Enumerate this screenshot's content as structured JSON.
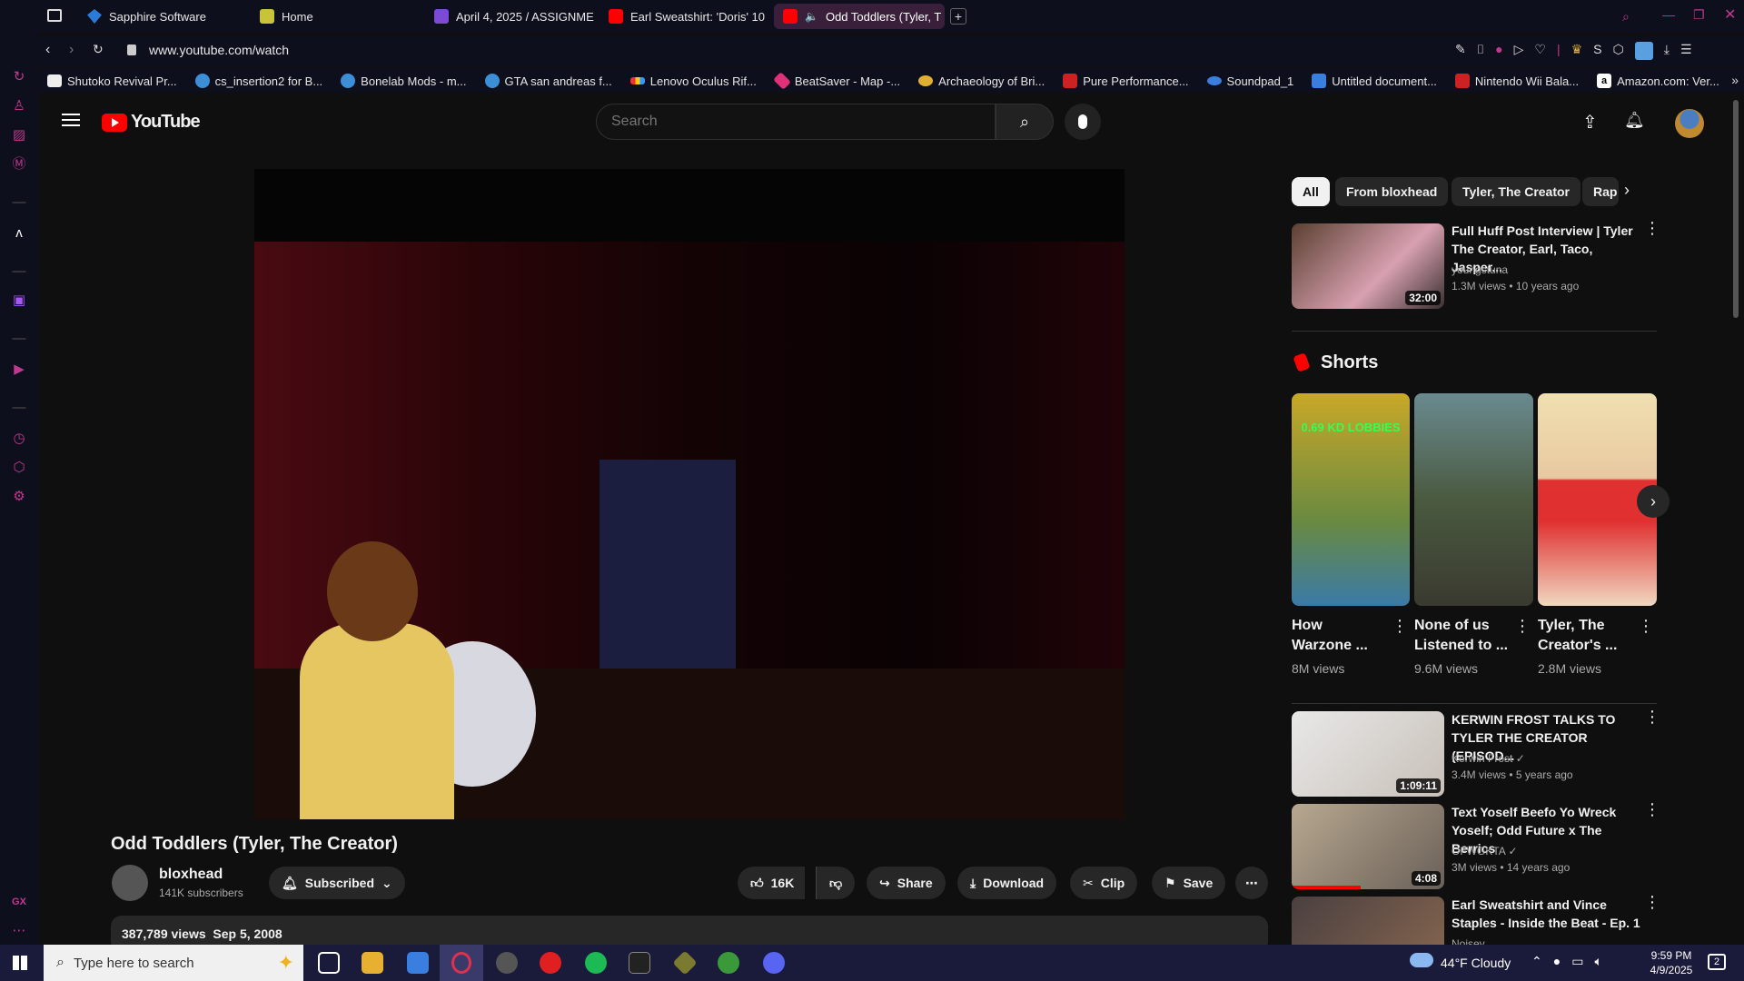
{
  "browser": {
    "tabs": [
      {
        "label": "Sapphire Software",
        "color": "#2b7bd6"
      },
      {
        "label": "Home",
        "color": "#c8c43a"
      },
      {
        "label": "April 4, 2025 / ASSIGNME",
        "color": "#7a4bd6"
      },
      {
        "label": "Earl Sweatshirt: 'Doris' 10",
        "color": "#ff0000"
      },
      {
        "label": "Odd Toddlers (Tyler, T",
        "color": "#ff0000",
        "active": true
      }
    ],
    "url": "www.youtube.com/watch",
    "bookmarks": [
      "Shutoko Revival Pr...",
      "cs_insertion2 for B...",
      "Bonelab Mods - m...",
      "GTA san andreas f...",
      "Lenovo Oculus Rif...",
      "BeatSaver - Map -...",
      "Archaeology of Bri...",
      "Pure Performance...",
      "Soundpad_1",
      "Untitled document...",
      "Nintendo Wii Bala...",
      "Amazon.com: Ver..."
    ]
  },
  "youtube": {
    "logo": "YouTube",
    "search_placeholder": "Search",
    "video": {
      "title": "Odd Toddlers (Tyler, The Creator)",
      "channel": "bloxhead",
      "subscribers": "141K subscribers",
      "subscribed_label": "Subscribed",
      "likes": "16K",
      "share": "Share",
      "download": "Download",
      "clip": "Clip",
      "save": "Save",
      "views": "387,789 views",
      "date": "Sep 5, 2008"
    },
    "chips": [
      "All",
      "From bloxhead",
      "Tyler, The Creator",
      "Rap"
    ],
    "shorts_heading": "Shorts",
    "recommendations": [
      {
        "title": "Full Huff Post Interview | Tyler The Creator, Earl, Taco, Jasper...",
        "channel": "youngstuna",
        "meta": "1.3M views  •  10 years ago",
        "duration": "32:00"
      },
      {
        "title": "KERWIN FROST TALKS TO TYLER THE CREATOR (EPISOD...",
        "channel": "Kerwin Frost",
        "meta": "3.4M views  •  5 years ago",
        "duration": "1:09:11"
      },
      {
        "title": "Text Yoself Beefo Yo Wreck Yoself; Odd Future x The Berrics",
        "channel": "OFWGKTA",
        "meta": "3M views  •  14 years ago",
        "duration": "4:08"
      },
      {
        "title": "Earl Sweatshirt and Vince Staples - Inside the Beat - Ep. 1",
        "channel": "Noisey",
        "meta": "",
        "duration": ""
      }
    ],
    "shorts": [
      {
        "title": "How Warzone ...",
        "views": "8M views",
        "overlay": "0.69 KD LOBBIES"
      },
      {
        "title": "None of us Listened to ...",
        "views": "9.6M views"
      },
      {
        "title": "Tyler, The Creator's ...",
        "views": "2.8M views"
      }
    ]
  },
  "taskbar": {
    "search_placeholder": "Type here to search",
    "weather": "44°F  Cloudy",
    "time": "9:59 PM",
    "date": "4/9/2025",
    "notification_count": "2"
  }
}
